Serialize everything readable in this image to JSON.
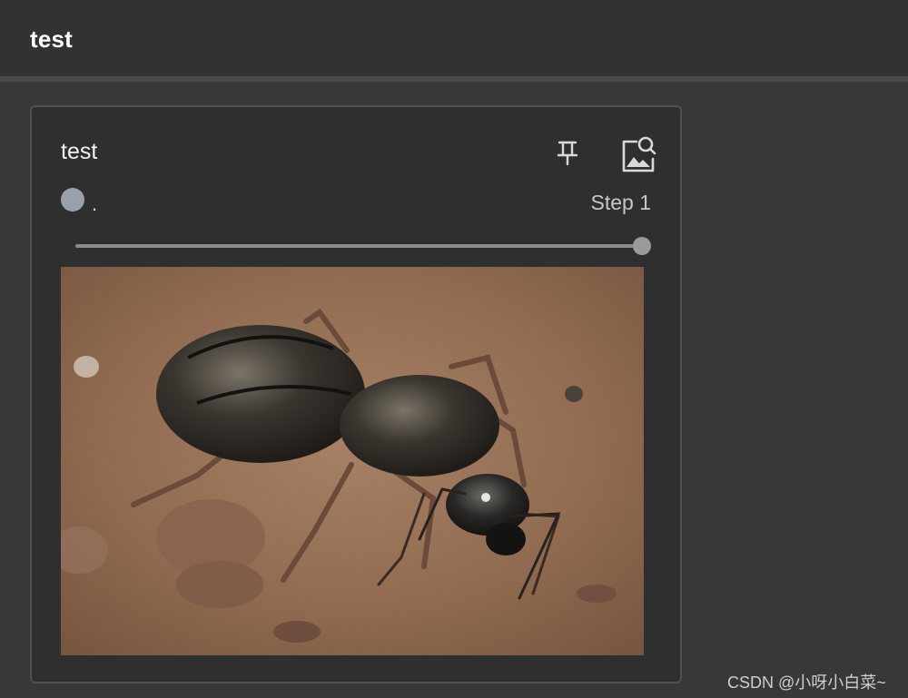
{
  "header": {
    "title": "test"
  },
  "card": {
    "title": "test",
    "run_name": ".",
    "step_label": "Step 1",
    "slider": {
      "value_fraction": 1.0
    },
    "icons": {
      "pin": "pin-icon",
      "image_search": "image-search-icon"
    },
    "image": {
      "alt": "ant on sand"
    }
  },
  "colors": {
    "background": "#383838",
    "topbar": "#323232",
    "card_bg": "#2f2f2f",
    "run_dot": "#9aa0ab"
  },
  "watermark": "CSDN @小呀小白菜~"
}
